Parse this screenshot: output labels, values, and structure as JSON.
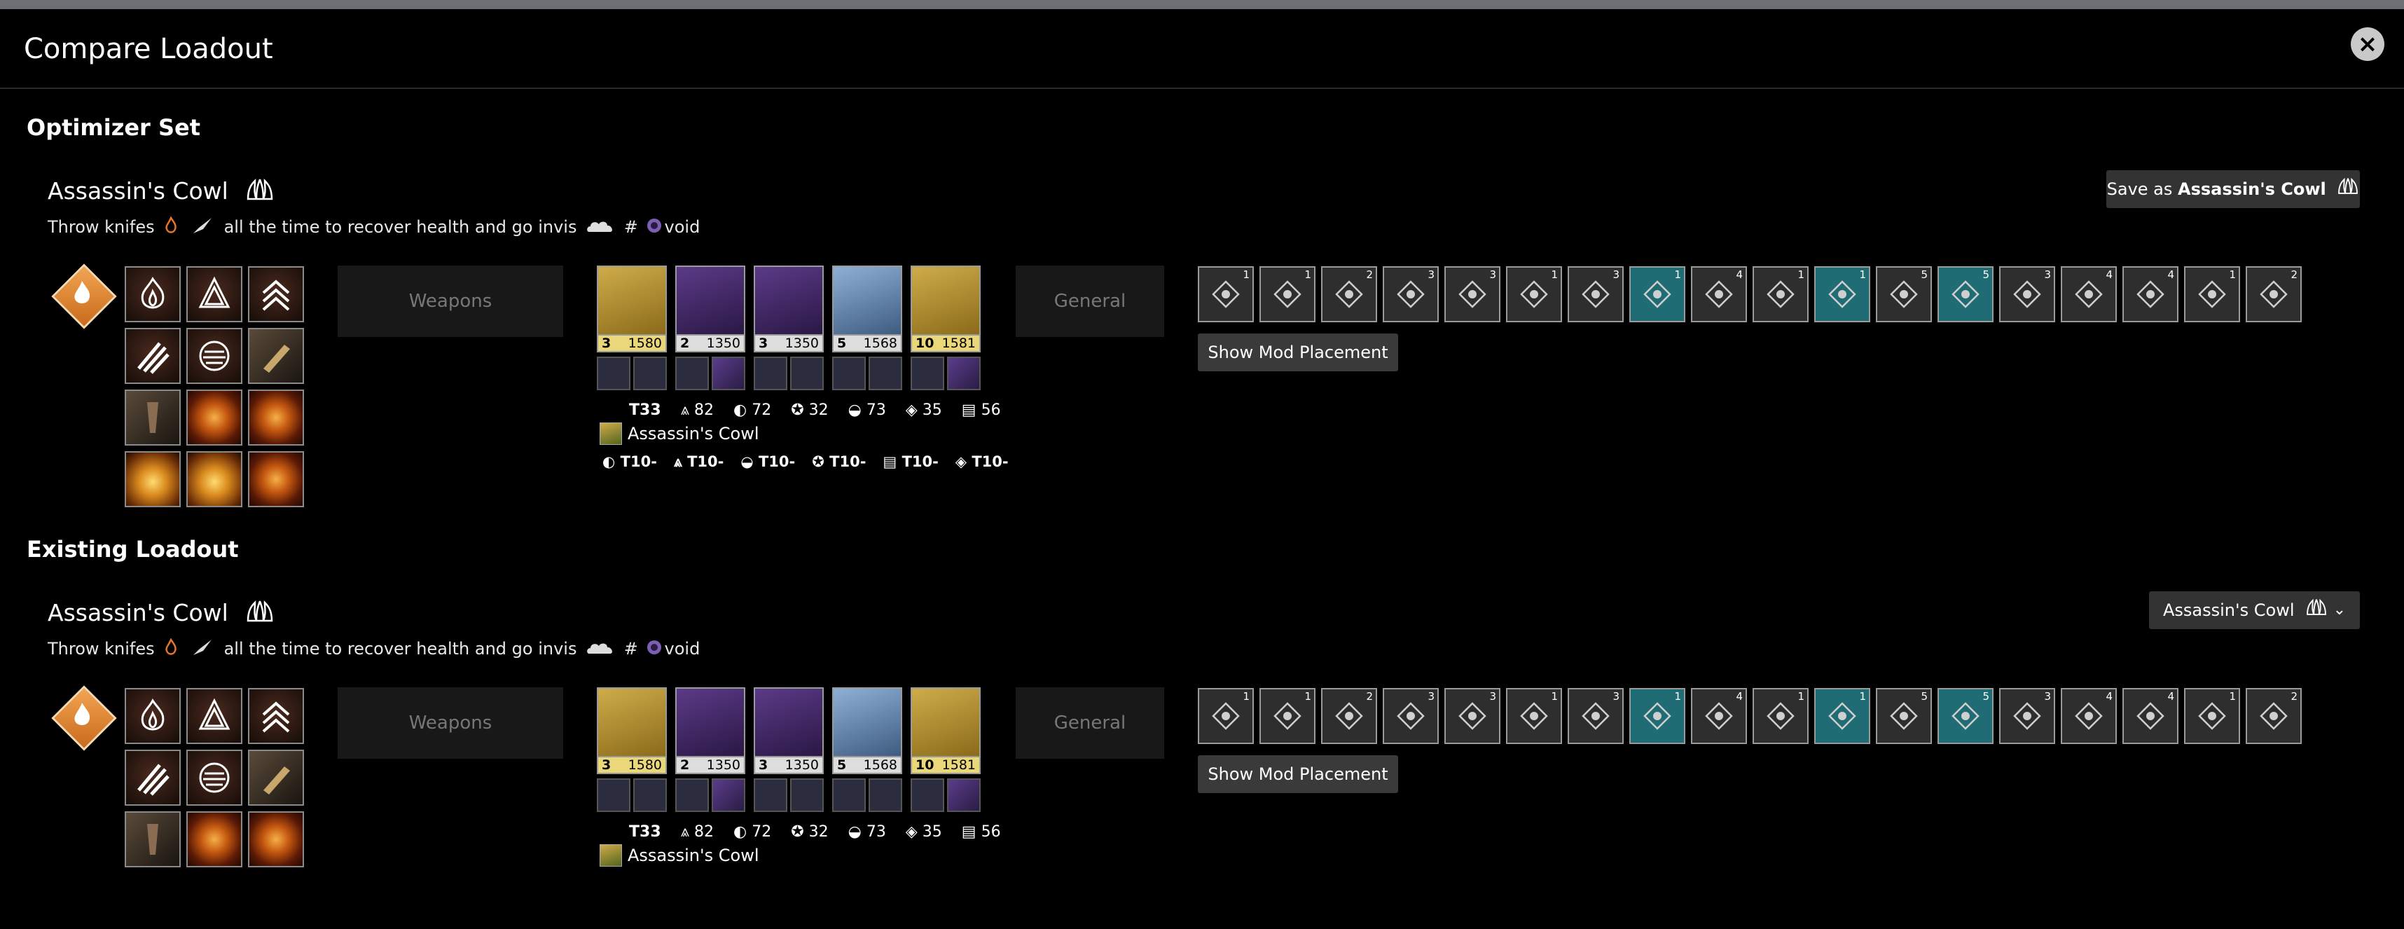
{
  "dialog": {
    "title": "Compare Loadout",
    "close_label": "×"
  },
  "optimizer": {
    "section_title": "Optimizer Set",
    "set_name": "Assassin's Cowl",
    "notes_parts": [
      "Throw knifes",
      "all the time to recover health and go invis",
      "#",
      "void"
    ],
    "save_prefix": "Save as ",
    "save_name": "Assassin's Cowl",
    "weapons_label": "Weapons",
    "general_label": "General",
    "armor": [
      {
        "level": "3",
        "power": "1580",
        "class": "exo"
      },
      {
        "level": "2",
        "power": "1350",
        "class": "leg"
      },
      {
        "level": "3",
        "power": "1350",
        "class": "leg"
      },
      {
        "level": "5",
        "power": "1568",
        "class": "leg2"
      },
      {
        "level": "10",
        "power": "1581",
        "class": "exo"
      }
    ],
    "stats": {
      "tier": "T33",
      "mobility": "82",
      "resilience": "72",
      "recovery": "32",
      "discipline": "73",
      "intellect": "35",
      "strength": "56"
    },
    "exotic_name": "Assassin's Cowl",
    "tier_values": [
      "T10-",
      "T10-",
      "T10-",
      "T10-",
      "T10-",
      "T10-"
    ],
    "mod_counts": [
      "1",
      "1",
      "2",
      "3",
      "3",
      "1",
      "3",
      "1",
      "4",
      "1",
      "1",
      "5",
      "5",
      "3",
      "4",
      "4",
      "1",
      "2"
    ],
    "show_mod_placement": "Show Mod Placement"
  },
  "existing": {
    "section_title": "Existing Loadout",
    "set_name": "Assassin's Cowl",
    "notes_parts": [
      "Throw knifes",
      "all the time to recover health and go invis",
      "#",
      "void"
    ],
    "dropdown_value": "Assassin's Cowl",
    "weapons_label": "Weapons",
    "general_label": "General",
    "armor": [
      {
        "level": "3",
        "power": "1580",
        "class": "exo"
      },
      {
        "level": "2",
        "power": "1350",
        "class": "leg"
      },
      {
        "level": "3",
        "power": "1350",
        "class": "leg"
      },
      {
        "level": "5",
        "power": "1568",
        "class": "leg2"
      },
      {
        "level": "10",
        "power": "1581",
        "class": "exo"
      }
    ],
    "stats": {
      "tier": "T33",
      "mobility": "82",
      "resilience": "72",
      "recovery": "32",
      "discipline": "73",
      "intellect": "35",
      "strength": "56"
    },
    "exotic_name": "Assassin's Cowl",
    "mod_counts": [
      "1",
      "1",
      "2",
      "3",
      "3",
      "1",
      "3",
      "1",
      "4",
      "1",
      "1",
      "5",
      "5",
      "3",
      "4",
      "4",
      "1",
      "2"
    ],
    "show_mod_placement": "Show Mod Placement"
  },
  "colors": {
    "accent_exotic": "#ceac4a",
    "legendary": "#5b3a88",
    "solar": "#f2a552",
    "teal_mod": "#1f6c74"
  }
}
